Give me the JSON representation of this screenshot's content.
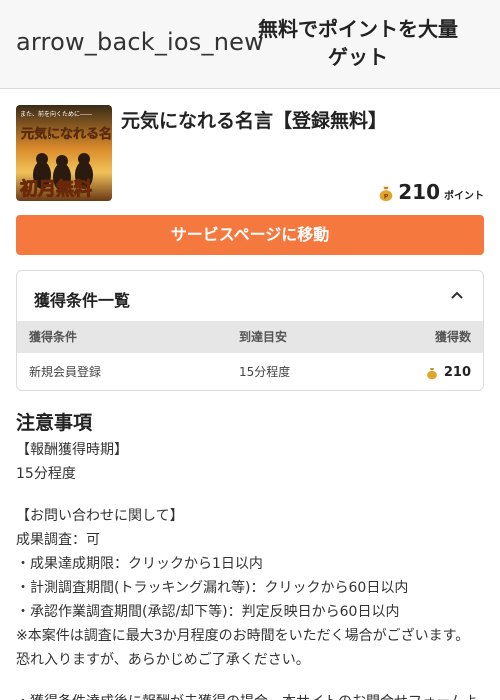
{
  "header": {
    "back_label": "arrow_back_ios_new",
    "title": "無料でポイントを大量ゲット"
  },
  "offer": {
    "thumbnail_top_text": "また、前を向くために――",
    "thumbnail_main_text": "元気になれる名言",
    "thumbnail_badge": "初月無料",
    "title": "元気になれる名言【登録無料】",
    "points_value": "210",
    "points_unit": "ポイント",
    "coin_icon": "money-bag-icon"
  },
  "cta": {
    "label": "サービスページに移動"
  },
  "conditions": {
    "title": "獲得条件一覧",
    "toggle_icon": "chevron-up-icon",
    "columns": [
      "獲得条件",
      "到達目安",
      "獲得数"
    ],
    "rows": [
      {
        "condition": "新規会員登録",
        "estimate": "15分程度",
        "reward": "210"
      }
    ]
  },
  "notes": {
    "title": "注意事項",
    "lines": [
      "【報酬獲得時期】",
      "15分程度",
      "",
      "【お問い合わせに関して】",
      "成果調査：可",
      "・成果達成期限：クリックから1日以内",
      "・計測調査期間(トラッキング漏れ等)：クリックから60日以内",
      "・承認作業調査期間(承認/却下等)：判定反映日から60日以内",
      "※本案件は調査に最大3か月程度のお時間をいただく場合がございます。",
      "恐れ入りますが、あらかじめご了承ください。",
      "",
      "・獲得条件達成後に報酬が未獲得の場合、本サイトのお問合せフォームよ"
    ]
  },
  "colors": {
    "accent": "#f5793f",
    "header_bg": "#f7f7f7",
    "table_header_bg": "#e6e6e6",
    "coin": "#e0a52a"
  }
}
